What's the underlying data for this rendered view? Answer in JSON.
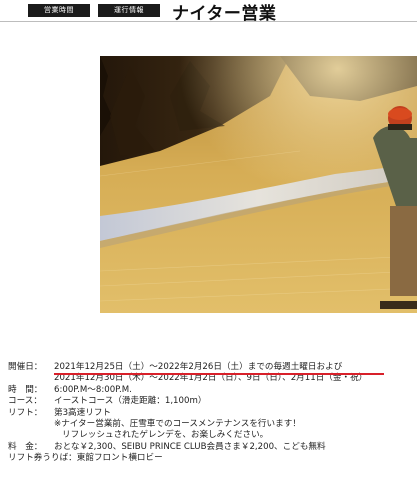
{
  "header": {
    "tab1": "営業時間",
    "tab2": "運行情報",
    "title": "ナイター営業"
  },
  "info": {
    "dates_label": "開催日：",
    "dates_main_part1": "2021年12月25日（土）～2022年2月26日（土）",
    "dates_main_part2": "までの毎週土曜日",
    "dates_main_part3": "および",
    "dates_extra": "2021年12月30日（木）～2022年1月2日（日）、9日（日）、2月11日（金・祝）",
    "time_label": "時　間：",
    "time_value": "6:00P.M～8:00P.M.",
    "course_label": "コース：",
    "course_value": "イーストコース（滑走距離：1,100m）",
    "lift_label": "リフト：",
    "lift_value": "第3高速リフト",
    "note1": "※ナイター営業前、圧雪車でのコースメンテナンスを行います！",
    "note2": "リフレッシュされたゲレンデを、お楽しみください。",
    "price_label": "料　金：",
    "price_value": "おとな￥2,300、SEIBU PRINCE CLUB会員さま￥2,200、こども無料",
    "ticket_label": "リフト券うりば：",
    "ticket_value": "東館フロント横ロビー"
  },
  "colors": {
    "accent_red": "#d8202a",
    "tab_bg": "#1b1b1b"
  }
}
